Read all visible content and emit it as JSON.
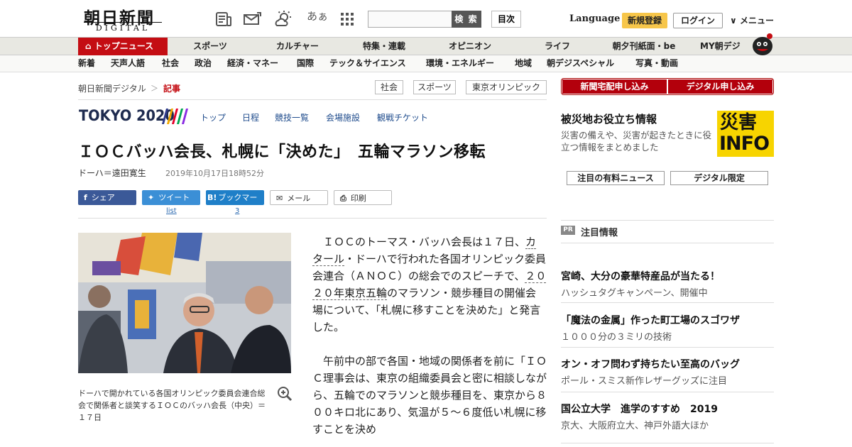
{
  "header": {
    "logo_jp": "朝日新聞",
    "logo_en": "DIGITAL",
    "font_size_label": "あぁ",
    "search_button": "検 索",
    "toc_button": "目次",
    "language": "Language",
    "signup": "新規登録",
    "login": "ログイン",
    "menu": "メニュー"
  },
  "nav_primary": {
    "top_news": "トップニュース",
    "items": [
      "スポーツ",
      "カルチャー",
      "特集・連載",
      "オピニオン",
      "ライフ",
      "朝夕刊紙面・be",
      "MY朝デジ"
    ]
  },
  "nav_secondary": {
    "items": [
      "新着",
      "天声人語",
      "社会",
      "政治",
      "経済・マネー",
      "国際",
      "テック＆サイエンス",
      "環境・エネルギー",
      "地域",
      "朝デジスペシャル",
      "写真・動画"
    ]
  },
  "breadcrumb": {
    "home": "朝日新聞デジタル",
    "sep": "＞",
    "current": "記事"
  },
  "tags": [
    "社会",
    "スポーツ",
    "東京オリンピック"
  ],
  "tokyo": {
    "logo": "TOKYO 2020",
    "links": [
      "トップ",
      "日程",
      "競技一覧",
      "会場施設",
      "観戦チケット"
    ],
    "stripe_colors": [
      "#2d3a8c",
      "#f2a900",
      "#e4002b",
      "#00a651",
      "#8a2be2"
    ]
  },
  "article": {
    "headline": "ＩＯＣバッハ会長、札幌に「決めた」　五輪マラソン移転",
    "byline": "ドーハ＝遠田寛生",
    "date": "2019年10月17日18時52分",
    "share": {
      "share": "シェア",
      "tweet": "ツイート",
      "bookmark": "ブックマーク",
      "mail": "メール",
      "print": "印刷",
      "tweet_count": "list",
      "bookmark_count": "3"
    },
    "caption": "ドーハで開かれている各国オリンピック委員会連合総会で関係者と談笑するＩＯＣのバッハ会長（中央）＝１７日",
    "p1_a": "ＩＯＣのトーマス・バッハ会長は１７日、",
    "p1_link1": "カタール",
    "p1_b": "・ドーハで行われた各国オリンピック委員会連合（ＡＮＯＣ）の総会でのスピーチで、",
    "p1_link2": "２０２０年東京五輪",
    "p1_c": "のマラソン・競歩種目の開催会場について、「札幌に移すことを決めた」と発言した。",
    "p2": "午前中の部で各国・地域の関係者を前に「ＩＯＣ理事会は、東京の組織委員会と密に相談しながら、五輪でのマラソンと競歩種目を、東京から８００キロ北にあり、気温が５～６度低い札幌に移すことを決め"
  },
  "sidebar": {
    "btn_delivery": "新聞宅配申し込み",
    "btn_digital": "デジタル申し込み",
    "disaster_title": "被災地お役立ち情報",
    "disaster_desc": "災害の備えや、災害が起きたときに役立つ情報をまとめました",
    "disaster_badge_kanji": "災害",
    "disaster_badge_en": "INFO",
    "tab_paid": "注目の有料ニュース",
    "tab_digital": "デジタル限定",
    "pr_badge": "PR",
    "pr_title": "注目情報",
    "pr_items": [
      {
        "title": "宮崎、大分の豪華特産品が当たる！",
        "sub": "ハッシュタグキャンペーン、開催中"
      },
      {
        "title": "「魔法の金属」作った町工場のスゴワザ",
        "sub": "１０００分の３ミリの技術"
      },
      {
        "title": "オン・オフ問わず持ちたい至高のバッグ",
        "sub": "ポール・スミス新作レザーグッズに注目"
      },
      {
        "title": "国公立大学　進学のすすめ　2019",
        "sub": "京大、大阪府立大、神戸外語大ほか"
      }
    ]
  },
  "colors": {
    "brand_red": "#c40d13",
    "signup_yellow": "#f7c64a",
    "share_blue": "#2c6ab0",
    "twitter_blue": "#3b8fd6",
    "hatena_blue": "#1f7fc8"
  }
}
